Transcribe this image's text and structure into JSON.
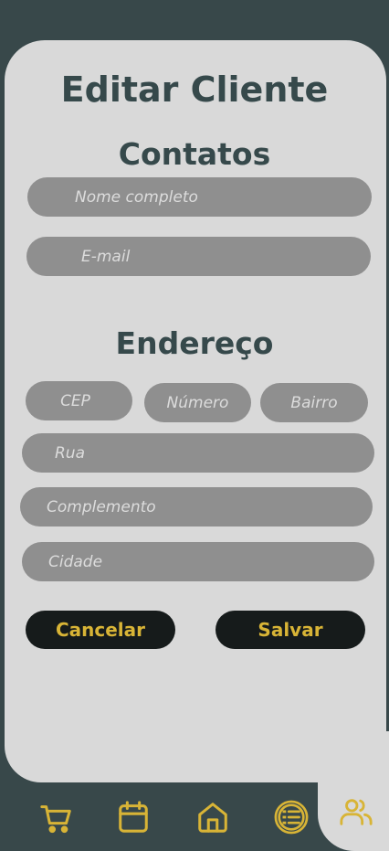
{
  "page": {
    "title": "Editar Cliente",
    "contacts_heading": "Contatos",
    "address_heading": "Endereço"
  },
  "form": {
    "name_placeholder": "Nome completo",
    "email_placeholder": "E-mail",
    "cep_placeholder": "CEP",
    "number_placeholder": "Número",
    "district_placeholder": "Bairro",
    "street_placeholder": "Rua",
    "complement_placeholder": "Complemento",
    "city_placeholder": "Cidade"
  },
  "actions": {
    "cancel_label": "Cancelar",
    "save_label": "Salvar"
  },
  "bottom_nav": {
    "items": [
      {
        "icon": "cart-icon",
        "active": false
      },
      {
        "icon": "calendar-icon",
        "active": false
      },
      {
        "icon": "home-icon",
        "active": false
      },
      {
        "icon": "list-icon",
        "active": false
      },
      {
        "icon": "users-icon",
        "active": true
      }
    ]
  },
  "colors": {
    "background": "#38484a",
    "card": "#d9d9d9",
    "field": "#8f8f8f",
    "accent": "#d8b436",
    "button": "#161b1b",
    "heading": "#36494b"
  }
}
